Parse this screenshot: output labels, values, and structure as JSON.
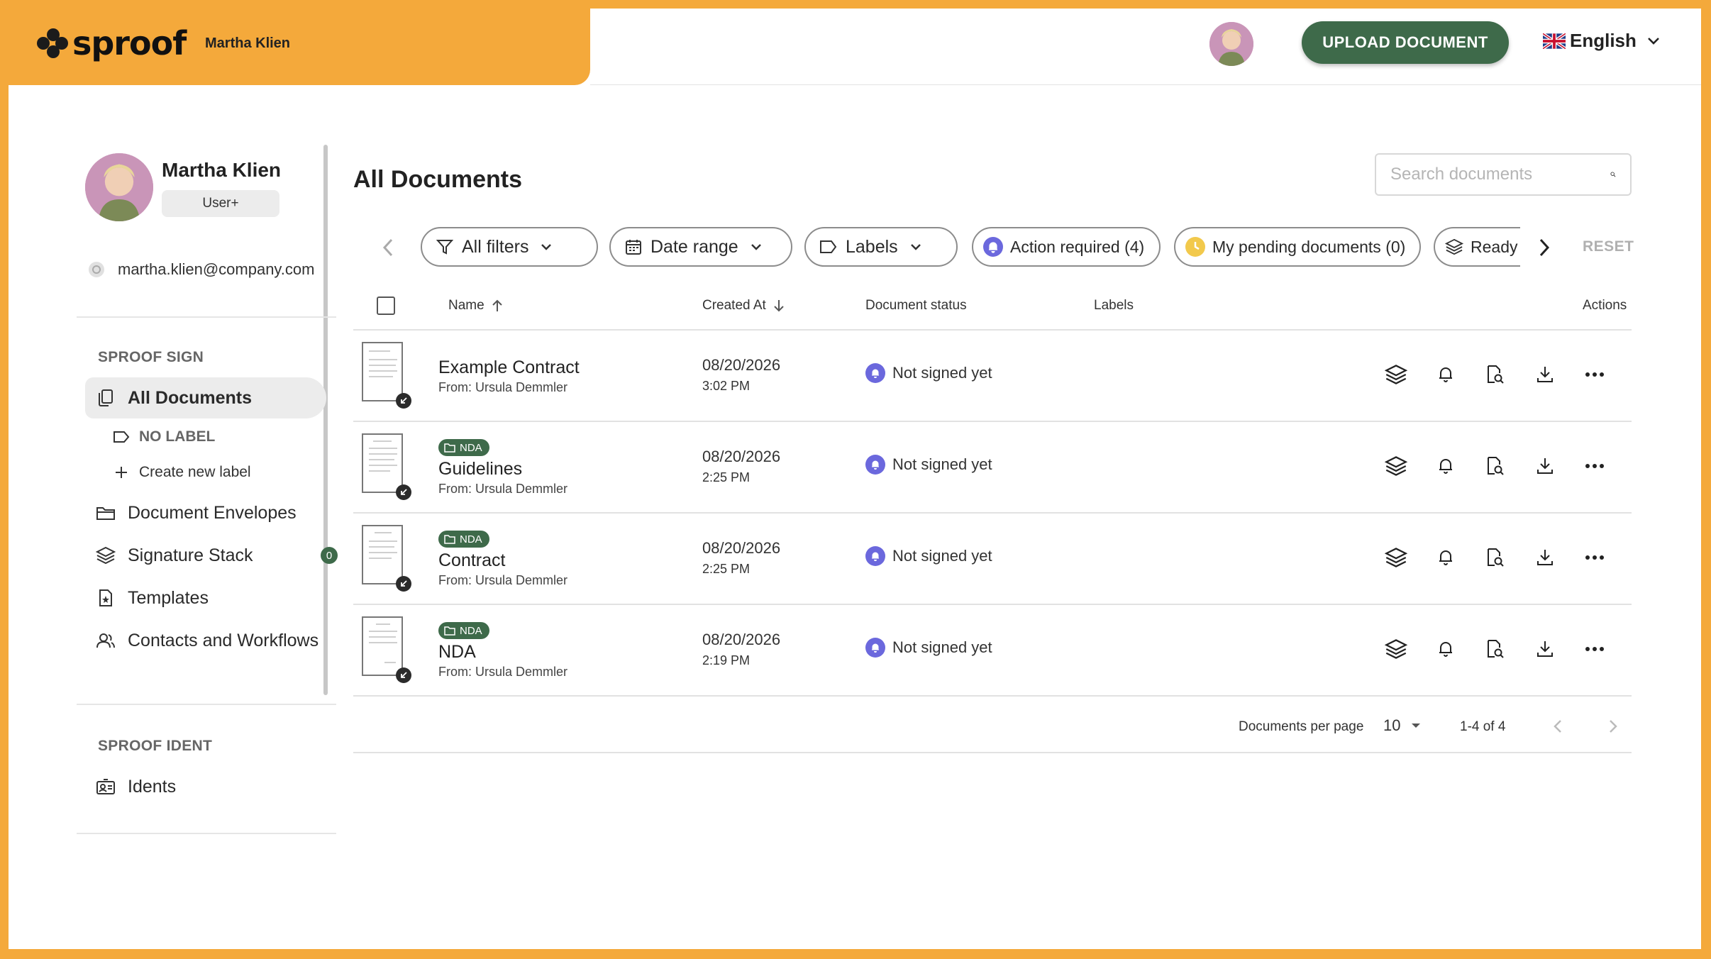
{
  "brand": {
    "logo_text": "sproof",
    "user_name": "Martha Klien"
  },
  "header": {
    "upload_label": "UPLOAD DOCUMENT",
    "language": "English"
  },
  "profile": {
    "name": "Martha Klien",
    "role": "User+",
    "email": "martha.klien@company.com"
  },
  "sidebar": {
    "section_sign": "SPROOF SIGN",
    "all_documents": "All Documents",
    "no_label": "NO LABEL",
    "create_label": "Create new label",
    "envelopes": "Document Envelopes",
    "signature_stack": "Signature Stack",
    "signature_stack_count": "0",
    "templates": "Templates",
    "contacts": "Contacts and Workflows",
    "section_ident": "SPROOF IDENT",
    "idents": "Idents"
  },
  "main": {
    "title": "All Documents",
    "search_placeholder": "Search documents",
    "filters": {
      "all_filters": "All filters",
      "date_range": "Date range",
      "labels": "Labels",
      "action_required": "Action required (4)",
      "my_pending": "My pending documents (0)",
      "ready": "Ready",
      "reset": "RESET"
    },
    "columns": {
      "name": "Name",
      "created_at": "Created At",
      "status": "Document status",
      "labels": "Labels",
      "actions": "Actions"
    },
    "rows": [
      {
        "name": "Example Contract",
        "from": "From: Ursula Demmler",
        "date": "08/20/2026",
        "time": "3:02 PM",
        "status": "Not signed yet",
        "tag": ""
      },
      {
        "name": "Guidelines",
        "from": "From: Ursula Demmler",
        "date": "08/20/2026",
        "time": "2:25 PM",
        "status": "Not signed yet",
        "tag": "NDA"
      },
      {
        "name": "Contract",
        "from": "From: Ursula Demmler",
        "date": "08/20/2026",
        "time": "2:25 PM",
        "status": "Not signed yet",
        "tag": "NDA"
      },
      {
        "name": "NDA",
        "from": "From: Ursula Demmler",
        "date": "08/20/2026",
        "time": "2:19 PM",
        "status": "Not signed yet",
        "tag": "NDA"
      }
    ],
    "pager": {
      "per_page_label": "Documents per page",
      "per_page": "10",
      "range": "1-4 of 4"
    }
  },
  "colors": {
    "brand_orange": "#f4a93b",
    "primary_green": "#3e6a4a",
    "status_purple": "#6b68dd",
    "pending_yellow": "#f2c94c"
  },
  "icons": [
    "filter-icon",
    "calendar-icon",
    "label-icon",
    "bell-icon",
    "clock-icon",
    "stack-icon",
    "search-icon",
    "preview-icon",
    "download-icon",
    "more-icon"
  ]
}
